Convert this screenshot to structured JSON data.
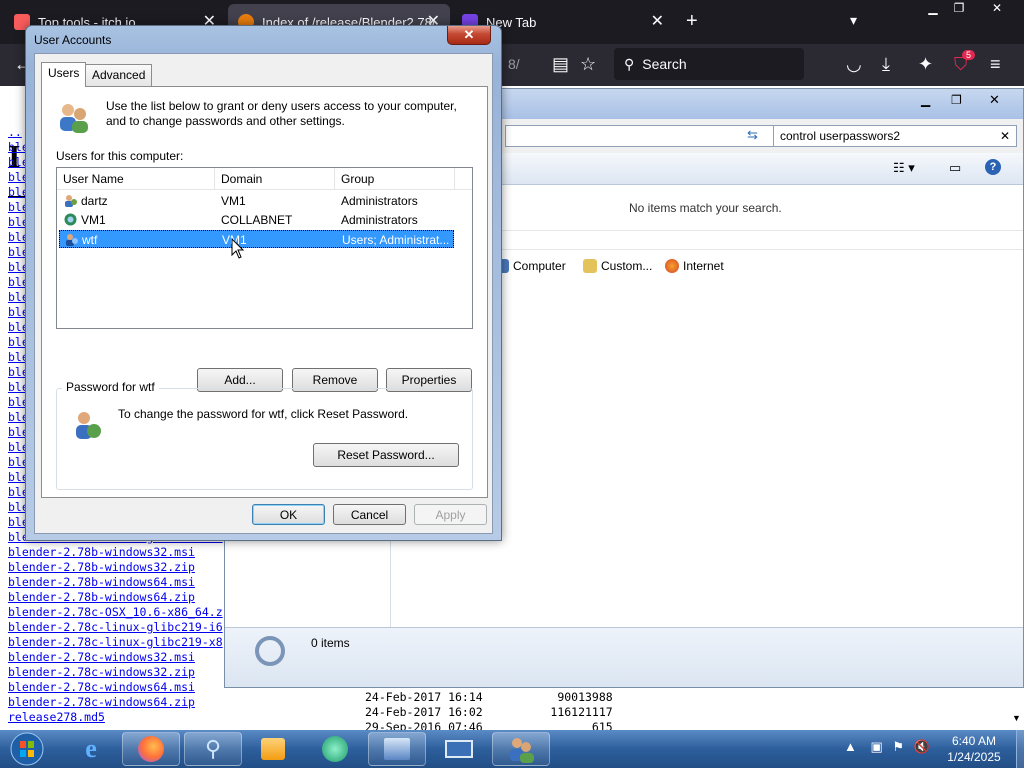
{
  "browser": {
    "tabs": [
      {
        "title": "Top tools - itch.io",
        "active": false
      },
      {
        "title": "Index of /release/Blender2.78/",
        "active": true
      },
      {
        "title": "New Tab",
        "active": false
      }
    ],
    "url_fragment": "8/",
    "search_placeholder": "Search",
    "extension_badge": "5"
  },
  "page": {
    "heading_fragment": "I",
    "links": [
      "..",
      "ble",
      "ble",
      "ble",
      "ble",
      "ble",
      "ble",
      "ble",
      "ble",
      "ble",
      "ble",
      "ble",
      "ble",
      "ble",
      "ble",
      "ble",
      "ble",
      "ble",
      "ble",
      "ble",
      "ble",
      "ble",
      "ble",
      "ble",
      "ble",
      "ble",
      "ble",
      "blender-2.78b-linux-glibc219-x8",
      "blender-2.78b-windows32.msi",
      "blender-2.78b-windows32.zip",
      "blender-2.78b-windows64.msi",
      "blender-2.78b-windows64.zip",
      "blender-2.78c-OSX_10.6-x86_64.z",
      "blender-2.78c-linux-glibc219-i6",
      "blender-2.78c-linux-glibc219-x8",
      "blender-2.78c-windows32.msi",
      "blender-2.78c-windows32.zip",
      "blender-2.78c-windows64.msi",
      "blender-2.78c-windows64.zip",
      "release278.md5"
    ],
    "meta_rows": [
      {
        "date": "24-Feb-2017 16:14",
        "size": "90013988"
      },
      {
        "date": "24-Feb-2017 16:02",
        "size": "116121117"
      },
      {
        "date": "29-Sep-2016 07:46",
        "size": "615"
      }
    ]
  },
  "explorer": {
    "search_value": "control userpasswors2",
    "empty_message": "No items match your search.",
    "locations": [
      "Computer",
      "Custom...",
      "Internet"
    ],
    "status": "0 items"
  },
  "dialog": {
    "title": "User Accounts",
    "close_glyph": "✕",
    "tabs": [
      "Users",
      "Advanced"
    ],
    "intro": "Use the list below to grant or deny users access to your computer, and to change passwords and other settings.",
    "users_label": "Users for this computer:",
    "columns": [
      "User Name",
      "Domain",
      "Group"
    ],
    "users": [
      {
        "name": "dartz",
        "domain": "VM1",
        "group": "Administrators"
      },
      {
        "name": "VM1",
        "domain": "COLLABNET",
        "group": "Administrators"
      },
      {
        "name": "wtf",
        "domain": "VM1",
        "group": "Users; Administrat..."
      }
    ],
    "buttons": {
      "add": "Add...",
      "remove": "Remove",
      "properties": "Properties",
      "reset": "Reset Password...",
      "ok": "OK",
      "cancel": "Cancel",
      "apply": "Apply"
    },
    "password_group": "Password for wtf",
    "password_text": "To change the password for wtf, click Reset Password."
  },
  "taskbar": {
    "time": "6:40 AM",
    "date": "1/24/2025"
  }
}
